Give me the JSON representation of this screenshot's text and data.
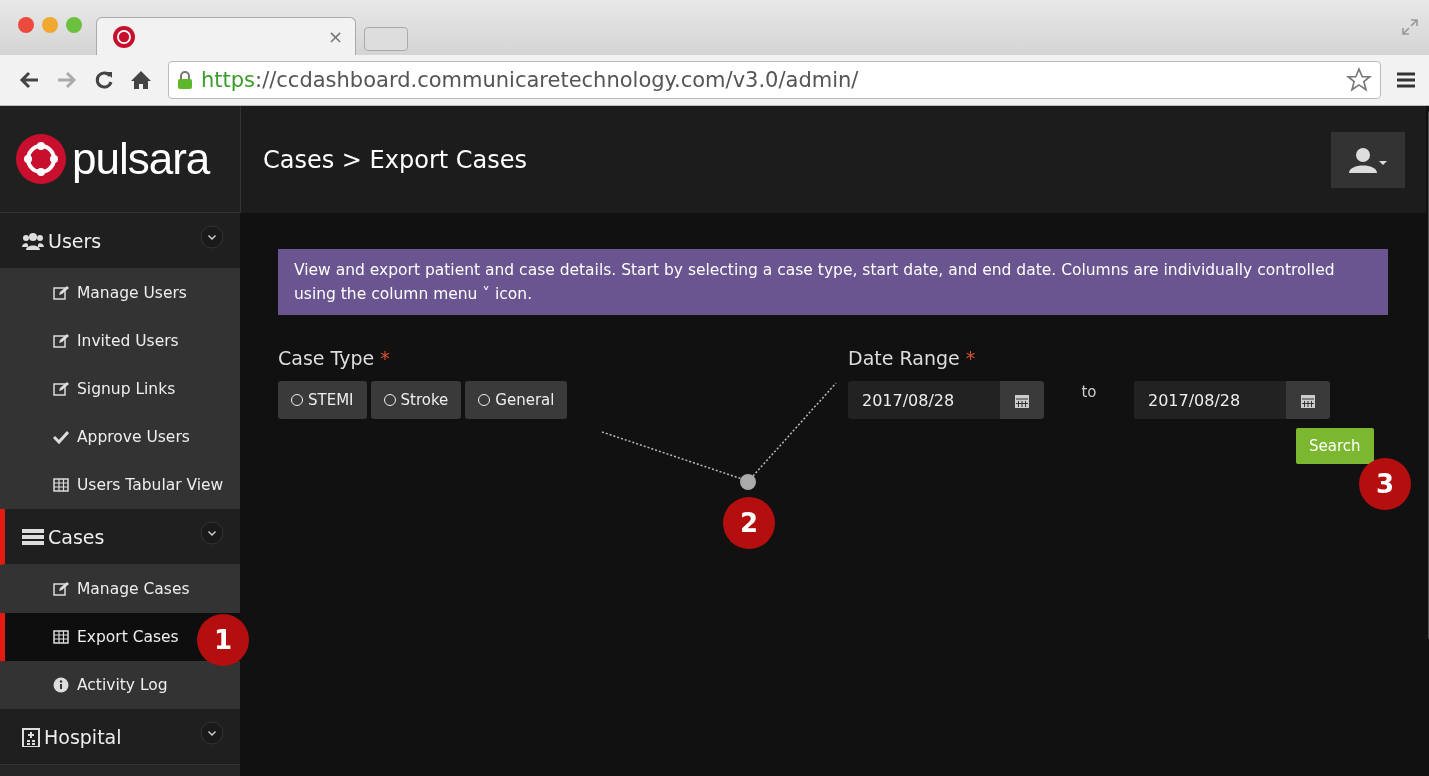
{
  "browser": {
    "tab_close": "×",
    "url": {
      "scheme": "https",
      "rest": "://ccdashboard.communicaretechnology.com/v3.0/admin/"
    }
  },
  "sidebar": {
    "logo_text": "pulsara",
    "sections": [
      {
        "label": "Users",
        "kind": "users",
        "selected": false,
        "children": [
          {
            "label": "Manage Users",
            "kind": "edit",
            "selected": false
          },
          {
            "label": "Invited Users",
            "kind": "edit",
            "selected": false
          },
          {
            "label": "Signup Links",
            "kind": "edit",
            "selected": false
          },
          {
            "label": "Approve Users",
            "kind": "check",
            "selected": false
          },
          {
            "label": "Users Tabular View",
            "kind": "table",
            "selected": false
          }
        ]
      },
      {
        "label": "Cases",
        "kind": "server",
        "selected": true,
        "children": [
          {
            "label": "Manage Cases",
            "kind": "edit",
            "selected": false
          },
          {
            "label": "Export Cases",
            "kind": "table",
            "selected": true
          },
          {
            "label": "Activity Log",
            "kind": "info",
            "selected": false
          }
        ]
      },
      {
        "label": "Hospital",
        "kind": "building",
        "selected": false
      }
    ]
  },
  "header": {
    "breadcrumb": "Cases > Export Cases"
  },
  "info_banner": "View and export patient and case details. Start by selecting a case type, start date, and end date. Columns are individually controlled using the column menu ˅ icon.",
  "case_type": {
    "label": "Case Type",
    "required_mark": "*",
    "options": [
      {
        "label": "STEMI",
        "selected": false
      },
      {
        "label": "Stroke",
        "selected": false
      },
      {
        "label": "General",
        "selected": false
      }
    ]
  },
  "date_range": {
    "label": "Date Range",
    "required_mark": "*",
    "start": "2017/08/28",
    "separator": "to",
    "end": "2017/08/28"
  },
  "search_button": "Search",
  "annotations": [
    "1",
    "2",
    "3"
  ]
}
